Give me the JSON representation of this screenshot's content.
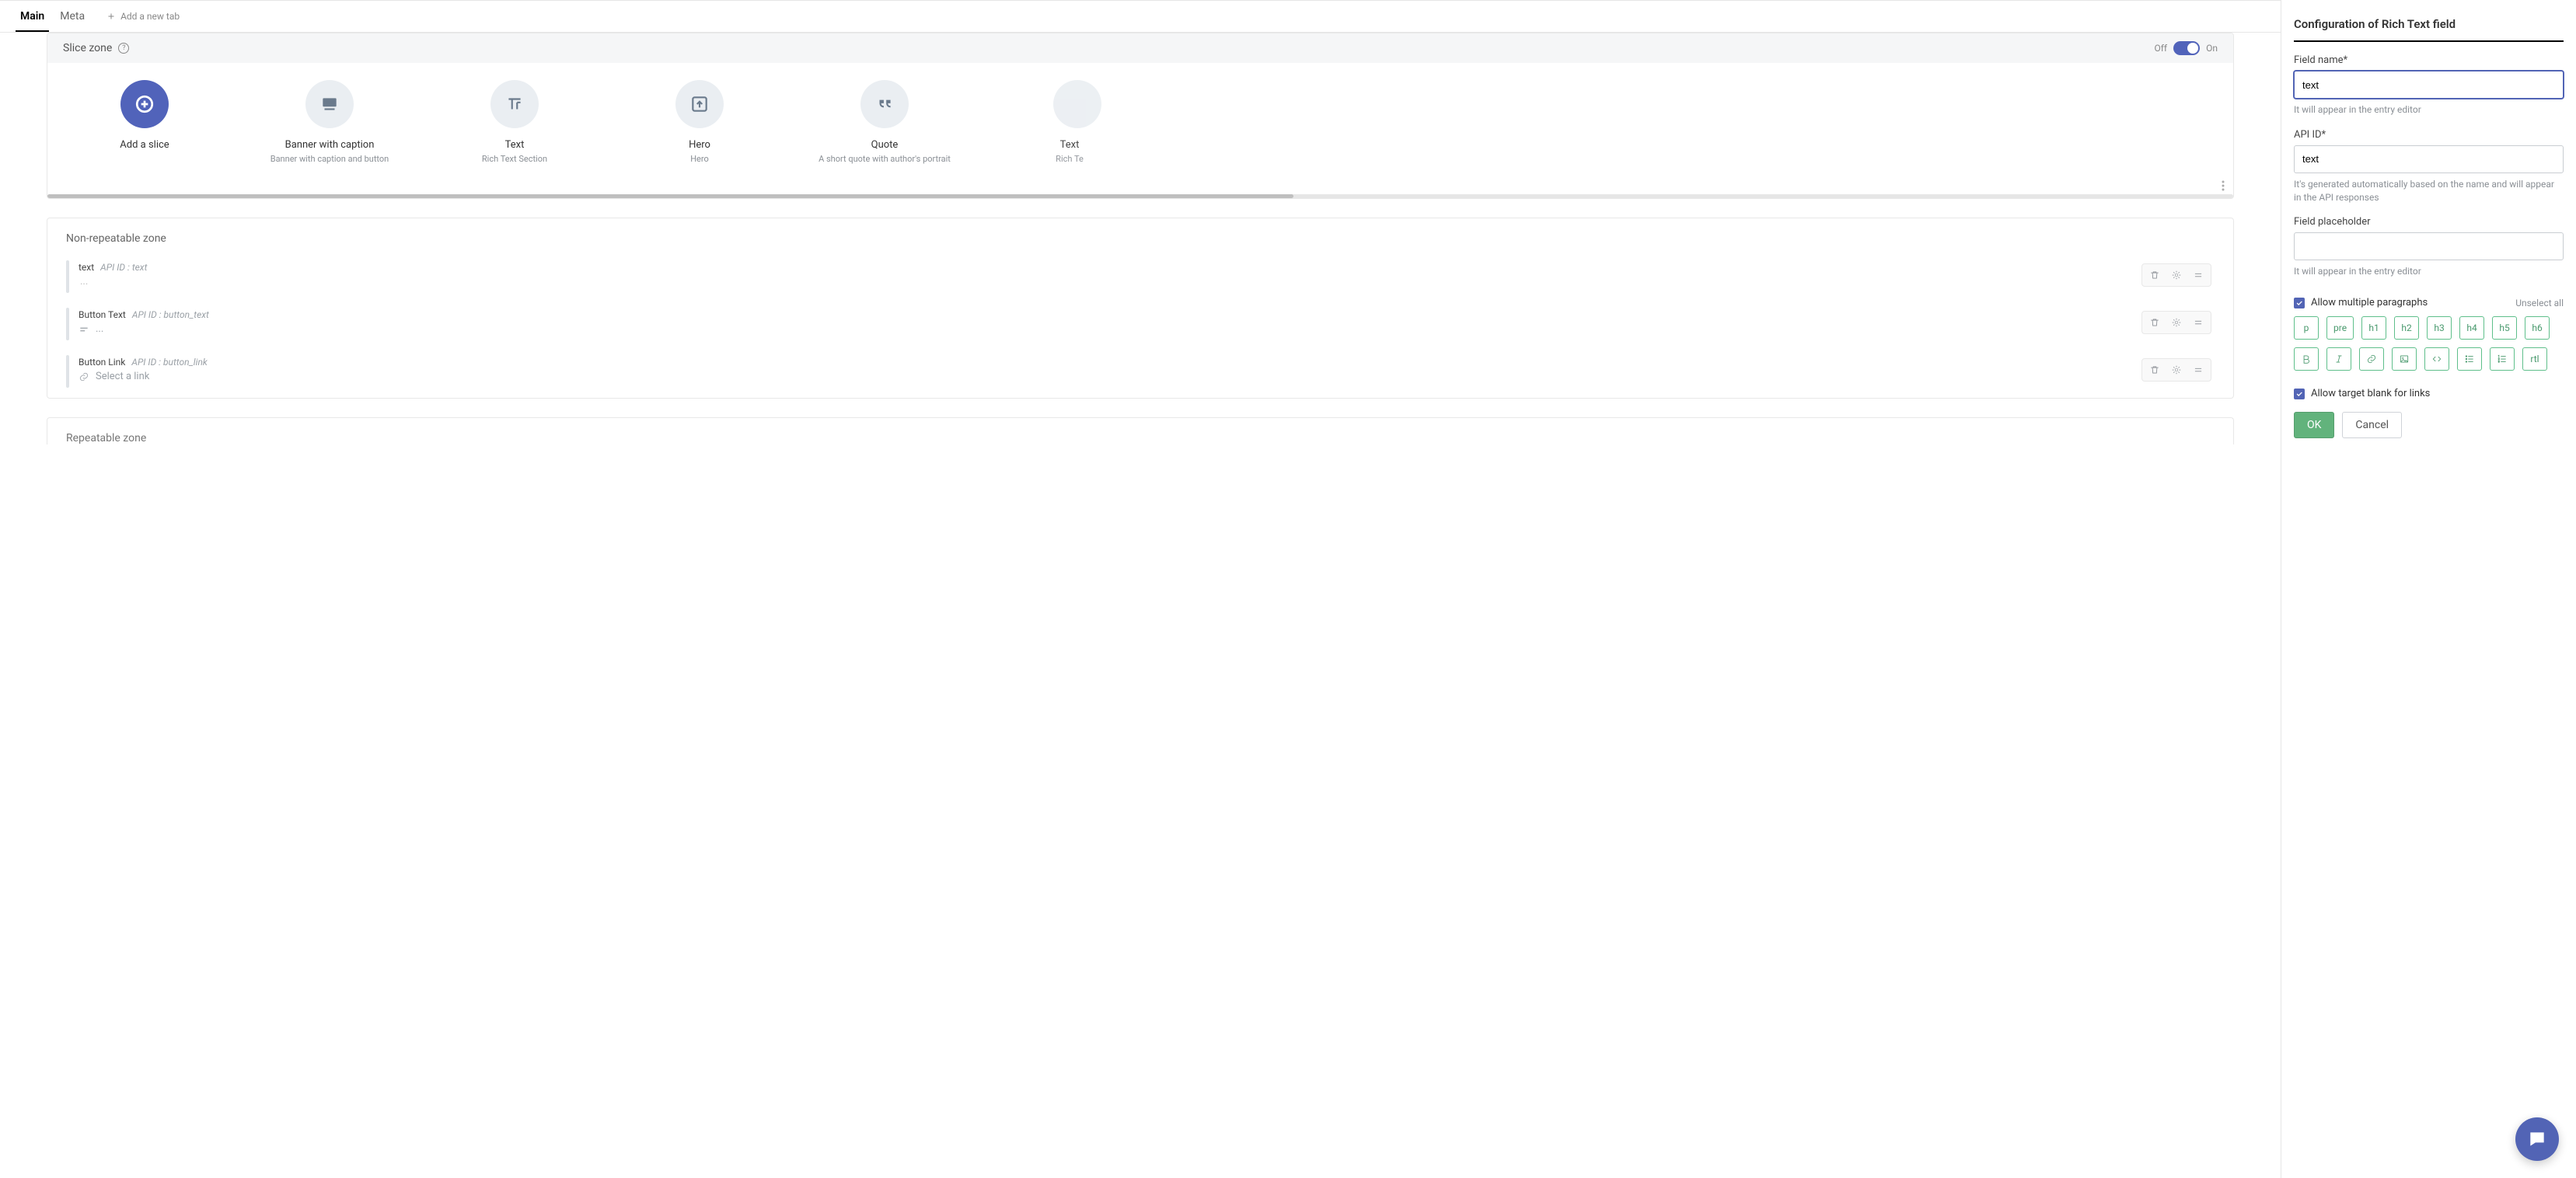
{
  "tabs": {
    "main": "Main",
    "meta": "Meta",
    "add_tab": "Add a new tab"
  },
  "slice_zone": {
    "title": "Slice zone",
    "off": "Off",
    "on": "On"
  },
  "slices": [
    {
      "title": "Add a slice",
      "subtitle": "",
      "icon": "add"
    },
    {
      "title": "Banner with caption",
      "subtitle": "Banner with caption and button",
      "icon": "image-caption"
    },
    {
      "title": "Text",
      "subtitle": "Rich Text Section",
      "icon": "text"
    },
    {
      "title": "Hero",
      "subtitle": "Hero",
      "icon": "upload"
    },
    {
      "title": "Quote",
      "subtitle": "A short quote with author's portrait",
      "icon": "quote"
    },
    {
      "title": "Text",
      "subtitle": "Rich Te",
      "icon": "text",
      "truncated": true
    }
  ],
  "zones": {
    "non_repeatable": "Non-repeatable zone",
    "repeatable": "Repeatable zone"
  },
  "fields": [
    {
      "name": "text",
      "api_label": "API ID :",
      "api_id": "text",
      "preview": "...",
      "type": "richtext"
    },
    {
      "name": "Button Text",
      "api_label": "API ID :",
      "api_id": "button_text",
      "preview": "...",
      "icon": "lines",
      "type": "richtext"
    },
    {
      "name": "Button Link",
      "api_label": "API ID :",
      "api_id": "button_link",
      "preview": "Select a link",
      "icon": "link",
      "type": "link"
    }
  ],
  "sidebar": {
    "title": "Configuration of Rich Text field",
    "field_name_label": "Field name*",
    "field_name_value": "text",
    "field_name_hint": "It will appear in the entry editor",
    "api_id_label": "API ID*",
    "api_id_value": "text",
    "api_id_hint": "It's generated automatically based on the name and will appear in the API responses",
    "placeholder_label": "Field placeholder",
    "placeholder_value": "",
    "placeholder_hint": "It will appear in the entry editor",
    "allow_multi": "Allow multiple paragraphs",
    "unselect_all": "Unselect all",
    "allow_target_blank": "Allow target blank for links",
    "ok": "OK",
    "cancel": "Cancel",
    "chips": {
      "p": "p",
      "pre": "pre",
      "h1": "h1",
      "h2": "h2",
      "h3": "h3",
      "h4": "h4",
      "h5": "h5",
      "h6": "h6",
      "rtl": "rtl"
    }
  }
}
